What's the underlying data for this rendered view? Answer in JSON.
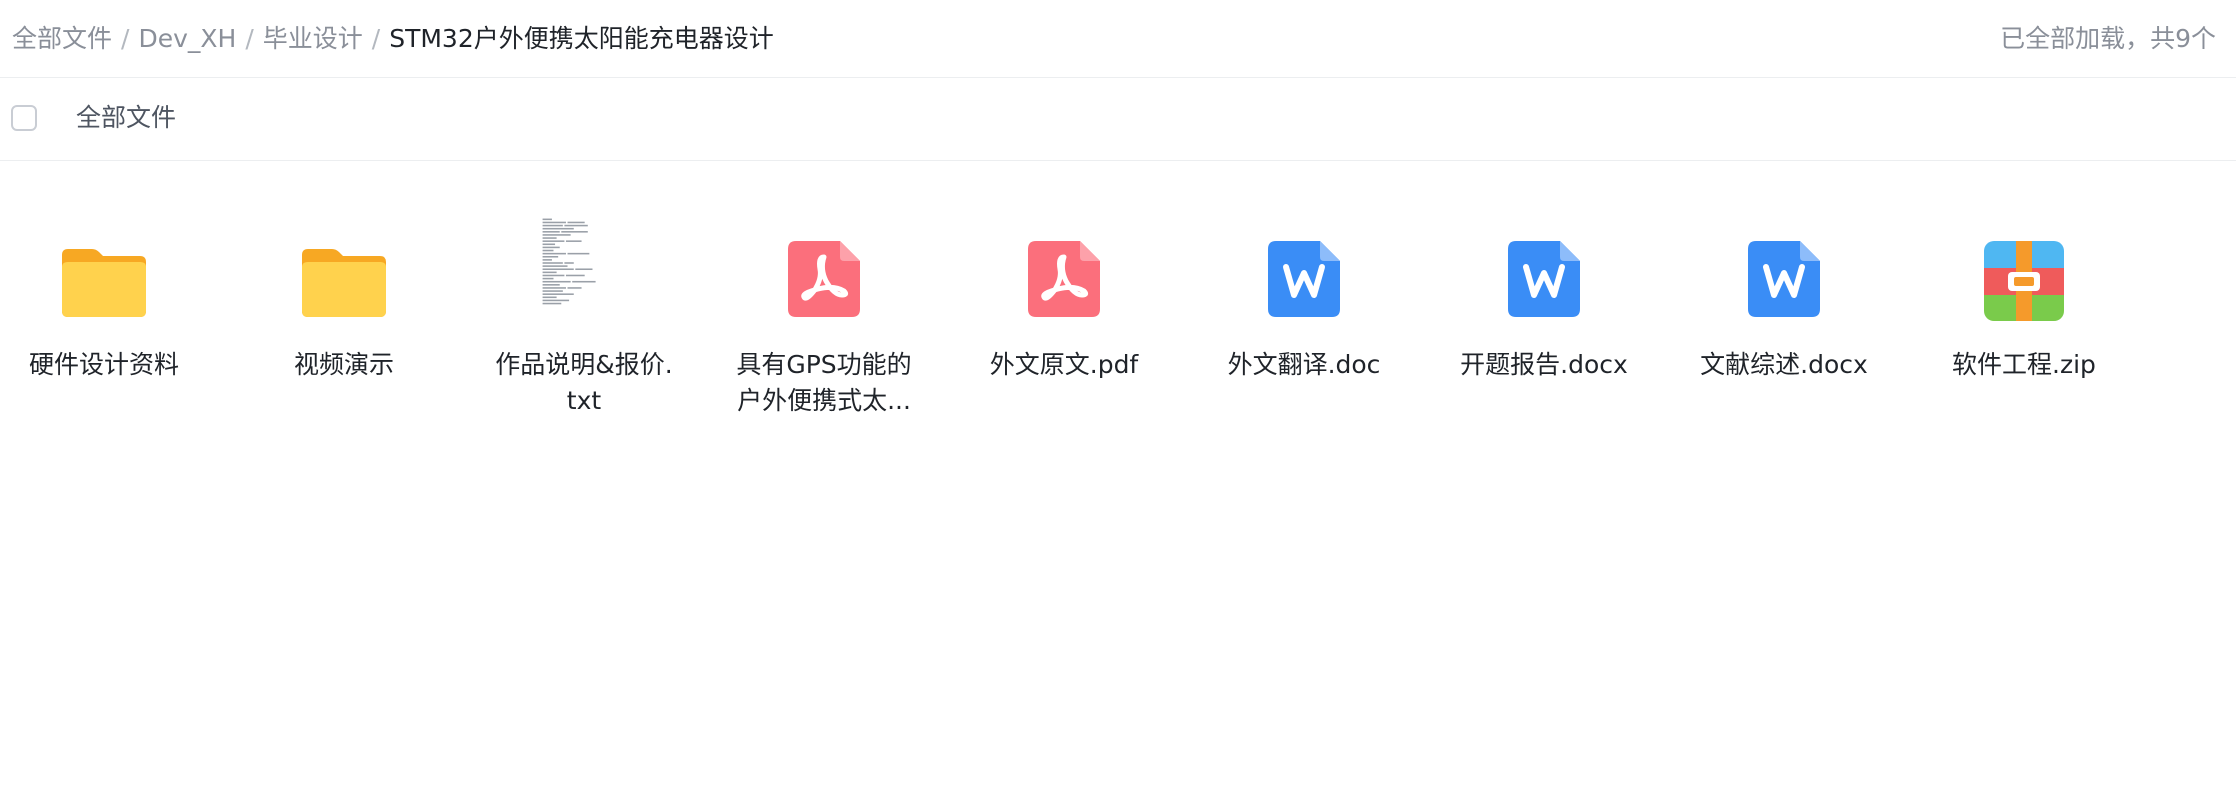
{
  "breadcrumb": {
    "items": [
      "全部文件",
      "Dev_XH",
      "毕业设计"
    ],
    "current": "STM32户外便携太阳能充电器设计",
    "separator": "/"
  },
  "status": {
    "text": "已全部加载，共9个"
  },
  "selectbar": {
    "label": "全部文件"
  },
  "colors": {
    "folder": "#ffc43d",
    "pdf": "#fb6f7c",
    "word": "#3a8df6",
    "zip_red": "#ef5b5b",
    "zip_blue": "#4fb7f2",
    "zip_green": "#7acb4b",
    "zip_orange": "#f59a2b"
  },
  "files": [
    {
      "type": "folder-icon",
      "name_lines": [
        "硬件设计资料"
      ]
    },
    {
      "type": "folder-icon",
      "name_lines": [
        "视频演示"
      ]
    },
    {
      "type": "txt-thumbnail",
      "name_lines": [
        "作品说明&报价.",
        "txt"
      ]
    },
    {
      "type": "pdf-icon",
      "name_lines": [
        "具有GPS功能的",
        "户外便携式太..."
      ]
    },
    {
      "type": "pdf-icon",
      "name_lines": [
        "外文原文.pdf"
      ]
    },
    {
      "type": "word-icon",
      "name_lines": [
        "外文翻译.doc"
      ]
    },
    {
      "type": "word-icon",
      "name_lines": [
        "开题报告.docx"
      ]
    },
    {
      "type": "word-icon",
      "name_lines": [
        "文献综述.docx"
      ]
    },
    {
      "type": "zip-icon",
      "name_lines": [
        "软件工程.zip"
      ]
    }
  ]
}
